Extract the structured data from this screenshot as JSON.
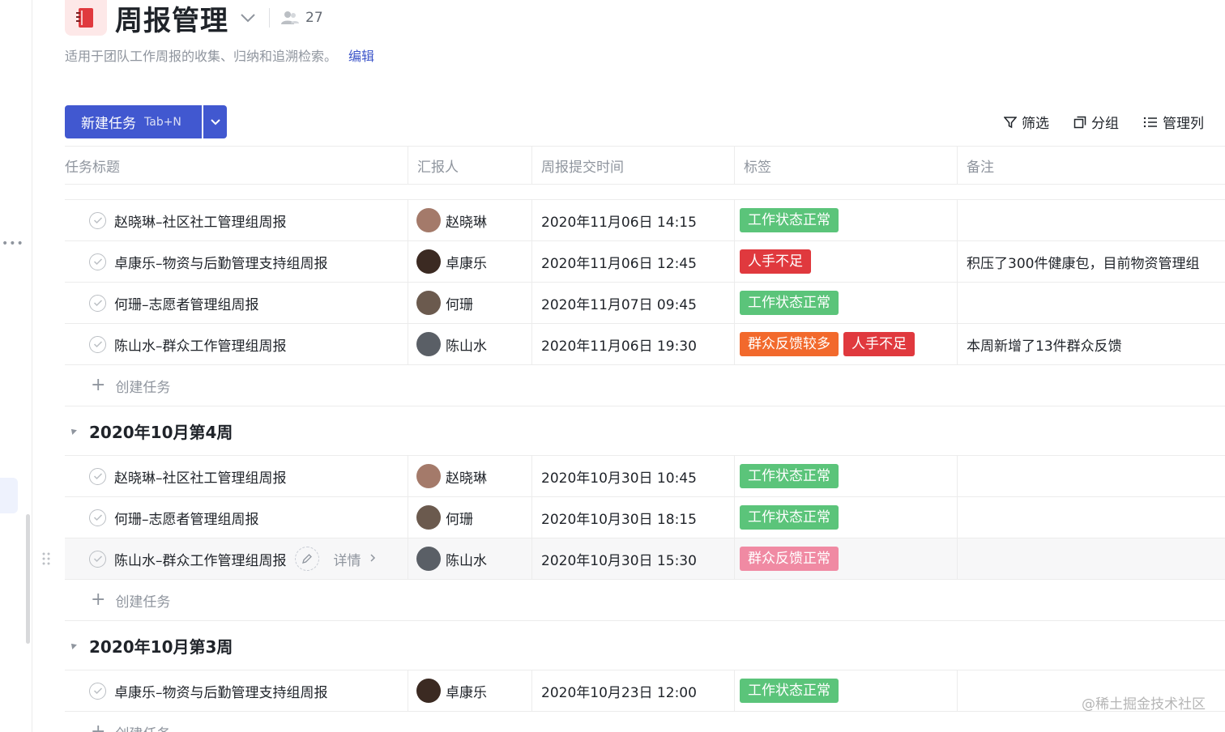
{
  "header": {
    "title": "周报管理",
    "member_count": "27"
  },
  "description": {
    "text": "适用于团队工作周报的收集、归纳和追溯检索。",
    "edit_label": "编辑"
  },
  "toolbar": {
    "new_task_label": "新建任务",
    "new_task_shortcut": "Tab+N",
    "filter_label": "筛选",
    "group_label": "分组",
    "manage_columns_label": "管理列"
  },
  "columns": [
    "任务标题",
    "汇报人",
    "周报提交时间",
    "标签",
    "备注"
  ],
  "create_task_label": "创建任务",
  "row_actions": {
    "detail_label": "详情"
  },
  "tag_colors": {
    "工作状态正常": "#5bc47a",
    "人手不足": "#e0393e",
    "群众反馈较多": "#f2692c",
    "群众反馈正常": "#f08aa3"
  },
  "groups": [
    {
      "label": "",
      "tasks": [
        {
          "title": "赵晓琳–社区社工管理组周报",
          "reporter": "赵晓琳",
          "avatar_color": "#a47a6a",
          "time": "2020年11月06日 14:15",
          "tags": [
            "工作状态正常"
          ],
          "note": ""
        },
        {
          "title": "卓康乐–物资与后勤管理支持组周报",
          "reporter": "卓康乐",
          "avatar_color": "#3b2a22",
          "time": "2020年11月06日 12:45",
          "tags": [
            "人手不足"
          ],
          "note": "积压了300件健康包，目前物资管理组"
        },
        {
          "title": "何珊–志愿者管理组周报",
          "reporter": "何珊",
          "avatar_color": "#6b5a4e",
          "time": "2020年11月07日 09:45",
          "tags": [
            "工作状态正常"
          ],
          "note": ""
        },
        {
          "title": "陈山水–群众工作管理组周报",
          "reporter": "陈山水",
          "avatar_color": "#5a5f66",
          "time": "2020年11月06日 19:30",
          "tags": [
            "群众反馈较多",
            "人手不足"
          ],
          "note": "本周新增了13件群众反馈"
        }
      ]
    },
    {
      "label": "2020年10月第4周",
      "tasks": [
        {
          "title": "赵晓琳–社区社工管理组周报",
          "reporter": "赵晓琳",
          "avatar_color": "#a47a6a",
          "time": "2020年10月30日 10:45",
          "tags": [
            "工作状态正常"
          ],
          "note": ""
        },
        {
          "title": "何珊–志愿者管理组周报",
          "reporter": "何珊",
          "avatar_color": "#6b5a4e",
          "time": "2020年10月30日 18:15",
          "tags": [
            "工作状态正常"
          ],
          "note": ""
        },
        {
          "title": "陈山水–群众工作管理组周报",
          "reporter": "陈山水",
          "avatar_color": "#5a5f66",
          "time": "2020年10月30日 15:30",
          "tags": [
            "群众反馈正常"
          ],
          "note": "",
          "hovered": true
        }
      ]
    },
    {
      "label": "2020年10月第3周",
      "tasks": [
        {
          "title": "卓康乐–物资与后勤管理支持组周报",
          "reporter": "卓康乐",
          "avatar_color": "#3b2a22",
          "time": "2020年10月23日 12:00",
          "tags": [
            "工作状态正常"
          ],
          "note": ""
        }
      ]
    }
  ],
  "watermark": "@稀土掘金技术社区"
}
